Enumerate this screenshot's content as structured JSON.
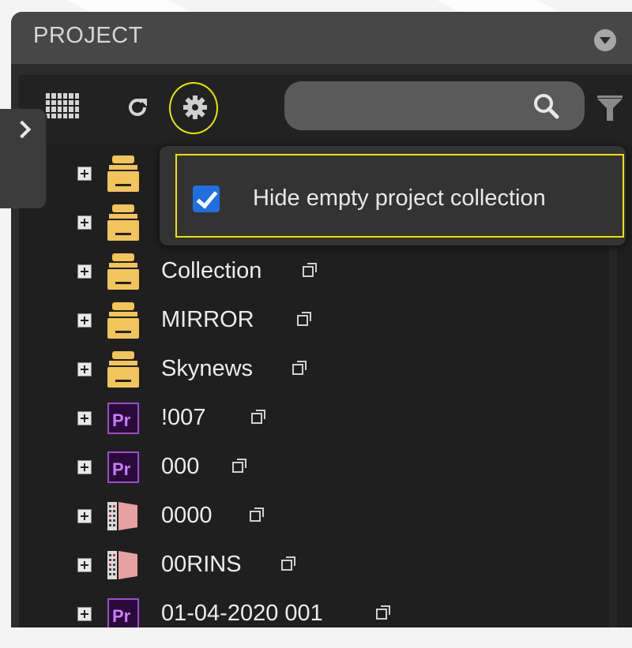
{
  "panel": {
    "title": "PROJECT"
  },
  "search": {
    "value": "",
    "placeholder": ""
  },
  "popup": {
    "option_label": "Hide empty project collection",
    "checked": true
  },
  "tree": {
    "items": [
      {
        "label": "",
        "type": "collection"
      },
      {
        "label": "",
        "type": "collection"
      },
      {
        "label": "Collection",
        "type": "collection"
      },
      {
        "label": "MIRROR",
        "type": "collection"
      },
      {
        "label": "Skynews",
        "type": "collection"
      },
      {
        "label": "!007",
        "type": "premiere-project"
      },
      {
        "label": "000",
        "type": "premiere-project"
      },
      {
        "label": "0000",
        "type": "sequence"
      },
      {
        "label": "00RINS",
        "type": "sequence"
      },
      {
        "label": "01-04-2020 001",
        "type": "premiere-project"
      }
    ]
  },
  "icons": {
    "header_menu": "dropdown-circle-icon",
    "side_toggle": "chevron-right-icon",
    "grid_view": "grid-view-icon",
    "refresh": "refresh-icon",
    "settings": "gear-icon",
    "search": "search-icon",
    "filter": "filter-icon",
    "expand": "plus-square-icon",
    "open": "open-window-icon"
  },
  "colors": {
    "highlight": "#f0e000",
    "checkbox": "#1f6fe0",
    "collection_icon": "#f2c45a",
    "premiere_icon": "#9b4dca"
  }
}
